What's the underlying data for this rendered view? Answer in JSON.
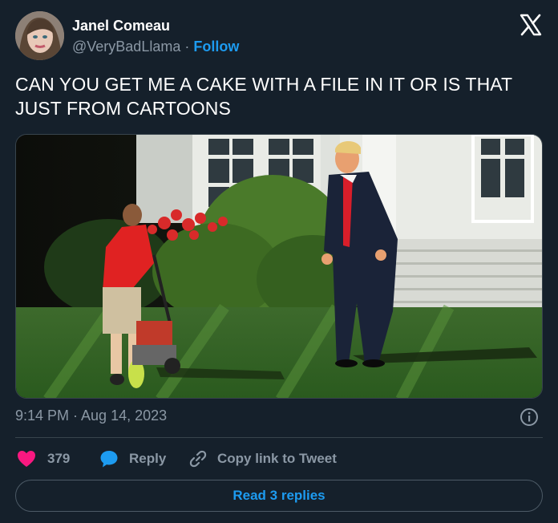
{
  "author": {
    "name": "Janel Comeau",
    "handle": "@VeryBadLlama",
    "separator": "·",
    "follow_label": "Follow"
  },
  "brand_icon": "x-logo-icon",
  "tweet": {
    "text": "CAN YOU GET ME A CAKE WITH A FILE IN IT OR IS THAT JUST FROM CARTOONS",
    "timestamp": "9:14 PM · Aug 14, 2023"
  },
  "actions": {
    "likes_count": "379",
    "reply_label": "Reply",
    "copy_label": "Copy link to Tweet"
  },
  "read_replies_label": "Read 3 replies",
  "colors": {
    "background": "#15202b",
    "accent": "#1d9bf0",
    "like": "#f91880",
    "muted": "#8b98a5",
    "border": "#38444d"
  },
  "icons": [
    "x-logo-icon",
    "info-icon",
    "heart-icon",
    "reply-bubble-icon",
    "link-icon"
  ]
}
